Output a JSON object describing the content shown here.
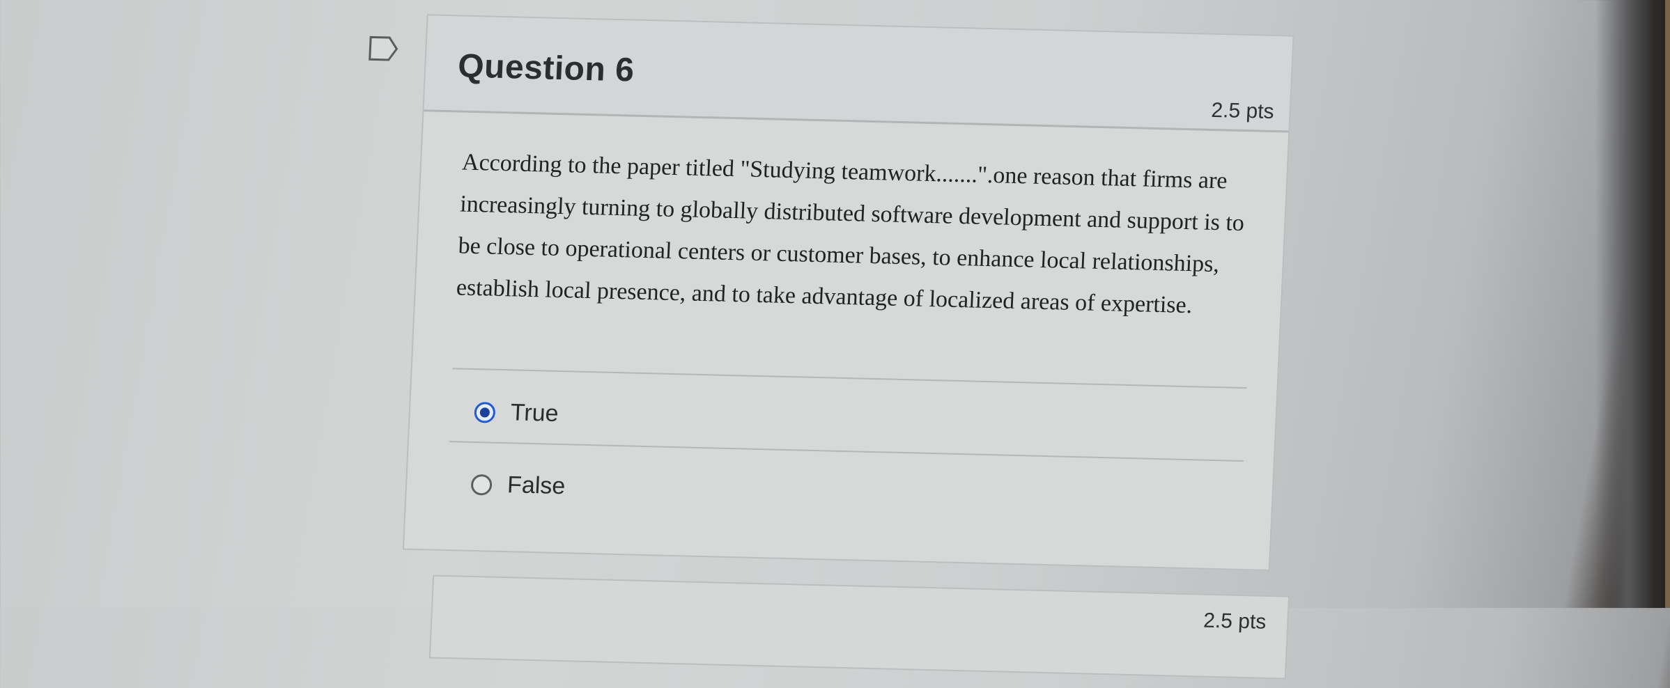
{
  "question": {
    "title": "Question 6",
    "points": "2.5 pts",
    "text": "According to the paper titled \"Studying teamwork.......\".one reason that firms are increasingly turning to globally distributed software development and support is to be close to operational centers or customer bases, to enhance local relationships, establish local presence, and to take advantage of localized areas of expertise.",
    "answers": [
      {
        "label": "True",
        "selected": true
      },
      {
        "label": "False",
        "selected": false
      }
    ]
  },
  "next_question": {
    "points": "2.5 pts"
  },
  "icons": {
    "flag": "flag-icon"
  },
  "colors": {
    "selected_radio": "#1f5bd6",
    "card_background": "#d7d8d8"
  }
}
